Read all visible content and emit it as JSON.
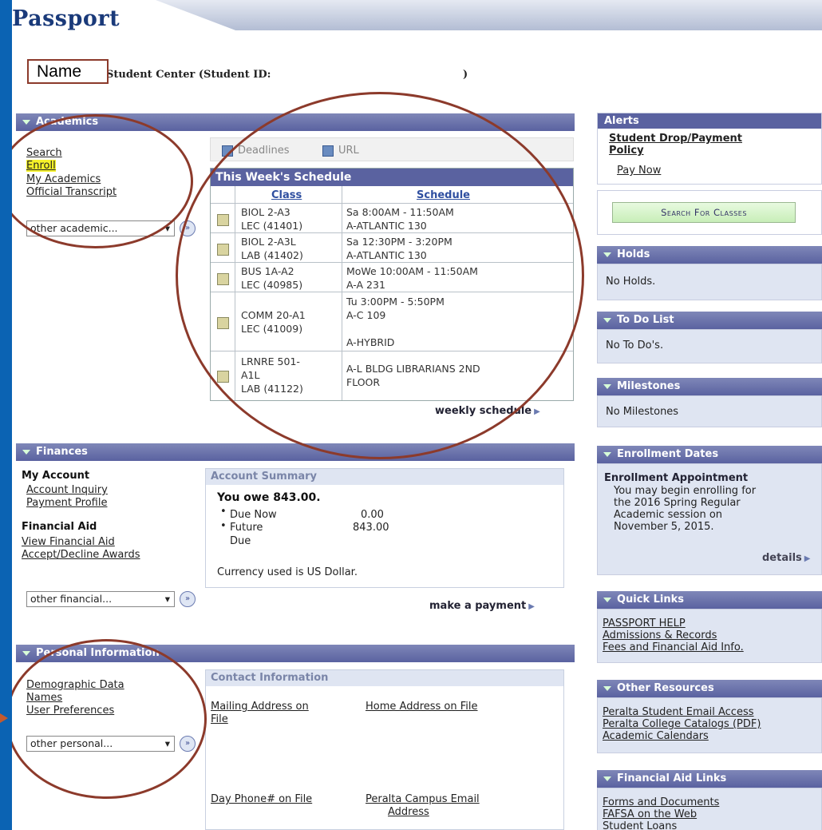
{
  "header": {
    "logo": "Passport",
    "name_label": "Name",
    "student_center": "Student Center (Student ID:",
    "id_close": ")"
  },
  "academics": {
    "title": "Academics",
    "links": [
      "Search",
      "Enroll",
      "My Academics",
      "Official Transcript"
    ],
    "select": "other academic...",
    "tabs": [
      "Deadlines",
      "URL"
    ],
    "schedule_title": "This Week's Schedule",
    "col_class": "Class",
    "col_schedule": "Schedule",
    "rows": [
      {
        "class1": "BIOL 2-A3",
        "class2": "LEC (41401)",
        "class3": "",
        "sched1": "Sa 8:00AM - 11:50AM",
        "sched2": "A-ATLANTIC 130",
        "sched3": "",
        "sched4": ""
      },
      {
        "class1": "BIOL 2-A3L",
        "class2": "LAB (41402)",
        "class3": "",
        "sched1": "Sa 12:30PM - 3:20PM",
        "sched2": "A-ATLANTIC 130",
        "sched3": "",
        "sched4": ""
      },
      {
        "class1": "BUS 1A-A2",
        "class2": "LEC (40985)",
        "class3": "",
        "sched1": "MoWe 10:00AM - 11:50AM",
        "sched2": "A-A 231",
        "sched3": "",
        "sched4": ""
      },
      {
        "class1": "COMM 20-A1",
        "class2": "LEC (41009)",
        "class3": "",
        "sched1": "Tu 3:00PM - 5:50PM",
        "sched2": "A-C 109",
        "sched3": "",
        "sched4": "A-HYBRID"
      },
      {
        "class1": "LRNRE 501-",
        "class2": "A1L",
        "class3": "LAB (41122)",
        "sched1": "A-L BLDG LIBRARIANS 2ND",
        "sched2": "FLOOR",
        "sched3": "",
        "sched4": ""
      }
    ],
    "weekly_link": "weekly schedule"
  },
  "finances": {
    "title": "Finances",
    "my_account": "My Account",
    "account_links": [
      "Account Inquiry",
      "Payment Profile"
    ],
    "financial_aid": "Financial Aid",
    "aid_links": [
      "View Financial Aid",
      "Accept/Decline Awards"
    ],
    "select": "other financial...",
    "summary_title": "Account Summary",
    "owe": "You owe 843.00.",
    "due_now_label": "Due Now",
    "due_now_value": "0.00",
    "future_label": "Future",
    "future_label2": "Due",
    "future_value": "843.00",
    "currency": "Currency used is US Dollar.",
    "payment_link": "make a payment"
  },
  "personal": {
    "title": "Personal Information",
    "links": [
      "Demographic Data",
      "Names",
      "User Preferences"
    ],
    "select": "other personal...",
    "contact_title": "Contact Information",
    "mailing1": "Mailing Address on",
    "mailing2": "File",
    "home": "Home Address on File",
    "phone": "Day Phone# on File",
    "email1": "Peralta Campus Email",
    "email2": "Address"
  },
  "alerts": {
    "title": "Alerts",
    "link1": "Student Drop/Payment",
    "link1b": "Policy",
    "link2": "Pay Now"
  },
  "search_button": "Search For Classes",
  "holds": {
    "title": "Holds",
    "text": "No Holds."
  },
  "todo": {
    "title": "To Do List",
    "text": "No To Do's."
  },
  "milestones": {
    "title": "Milestones",
    "text": "No Milestones"
  },
  "enrollment": {
    "title": "Enrollment Dates",
    "heading": "Enrollment Appointment",
    "lines": [
      "You may begin enrolling for",
      "the 2016 Spring Regular",
      "Academic session on",
      "November 5, 2015."
    ],
    "details": "details"
  },
  "quick_links": {
    "title": "Quick Links",
    "links": [
      "PASSPORT HELP",
      "Admissions & Records",
      "Fees and Financial Aid Info."
    ]
  },
  "other_resources": {
    "title": "Other Resources",
    "links": [
      "Peralta Student Email Access",
      "Peralta College Catalogs (PDF)",
      "Academic Calendars"
    ]
  },
  "aid_links": {
    "title": "Financial Aid Links",
    "links": [
      "Forms and Documents",
      "FAFSA on the Web",
      "Student Loans"
    ]
  },
  "colors": {
    "frame": "#0b63b3",
    "bar": "#5a62a0",
    "annotation": "#8c3a2b",
    "highlight": "#f6f22a"
  }
}
